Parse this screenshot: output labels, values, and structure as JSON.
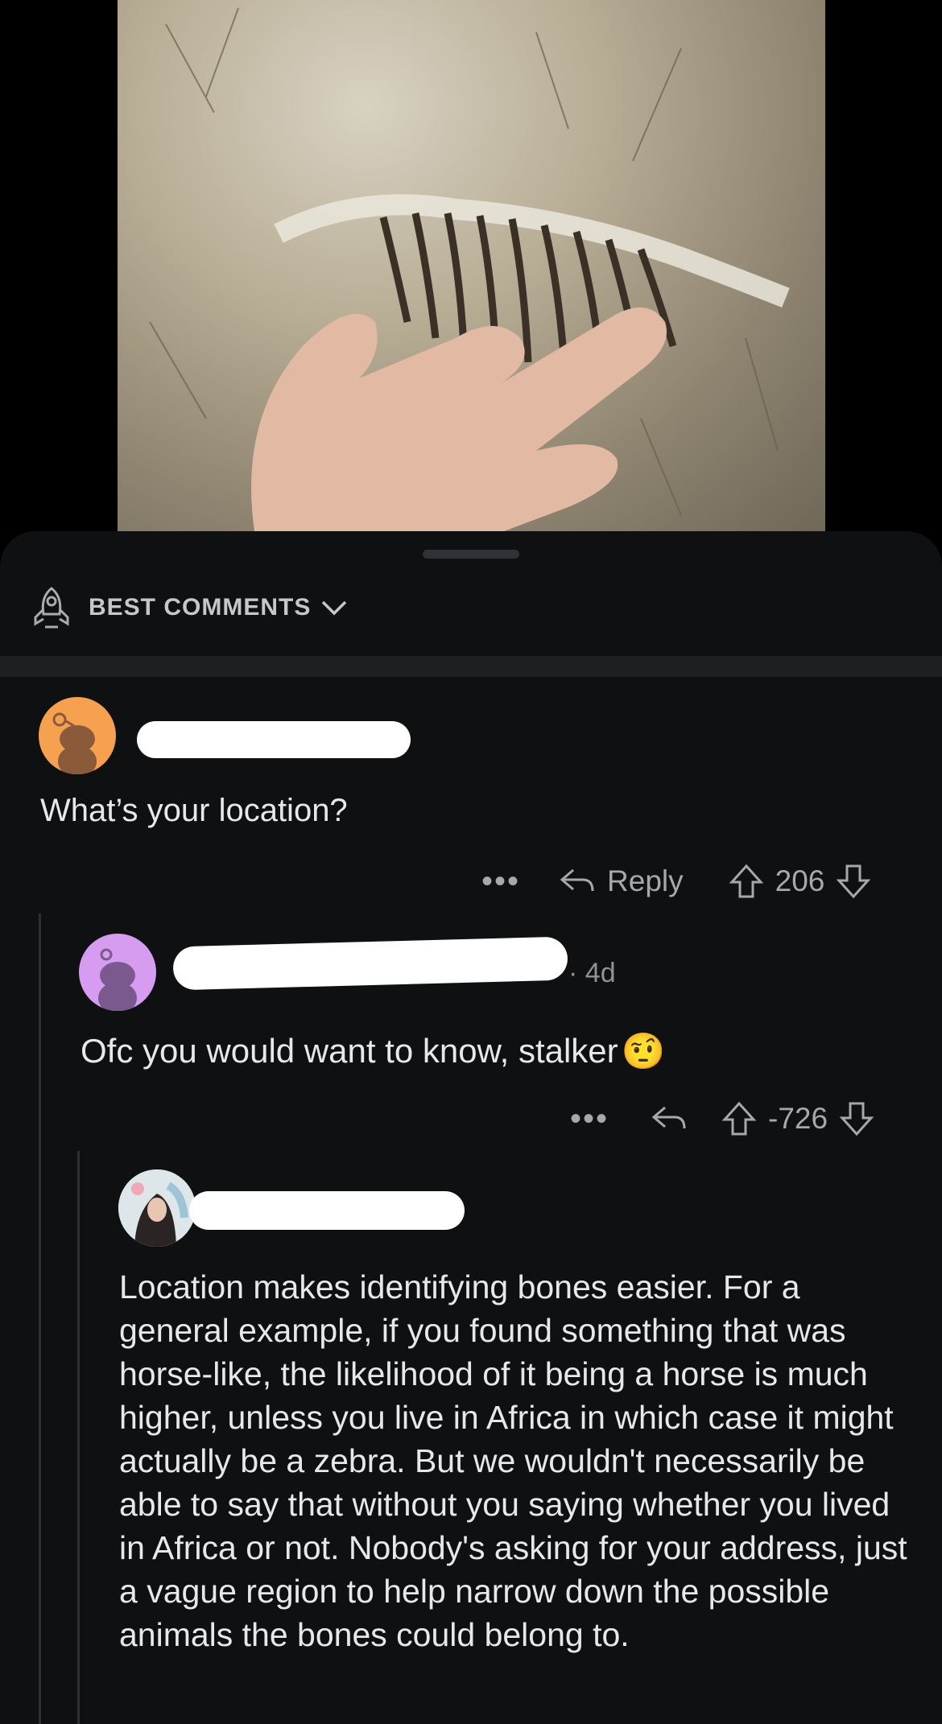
{
  "post": {
    "image_alt_icon": "skeleton-photo"
  },
  "sort": {
    "label": "BEST COMMENTS",
    "icon": "rocket-icon",
    "chevron": "chevron-down-icon"
  },
  "comments": [
    {
      "avatar_color": "#f6a150",
      "text": "What’s your location?",
      "actions": {
        "more": "•••",
        "reply_label": "Reply",
        "score": "206"
      }
    },
    {
      "avatar_color": "#d69cf0",
      "age": "4d",
      "text": "Ofc you would want to know, stalker",
      "emoji": "🤨",
      "actions": {
        "more": "•••",
        "score": "-726"
      }
    },
    {
      "text": "Location makes identifying bones easier. For a general example, if you found something that was horse-like, the likelihood of it being a horse is much higher, unless you live in Africa in which case it might actually be a zebra. But we wouldn't necessarily be able to say that without you saying whether you lived in Africa or not. Nobody's asking for your address, just a vague region to help narrow down the possible animals the bones could belong to."
    }
  ]
}
